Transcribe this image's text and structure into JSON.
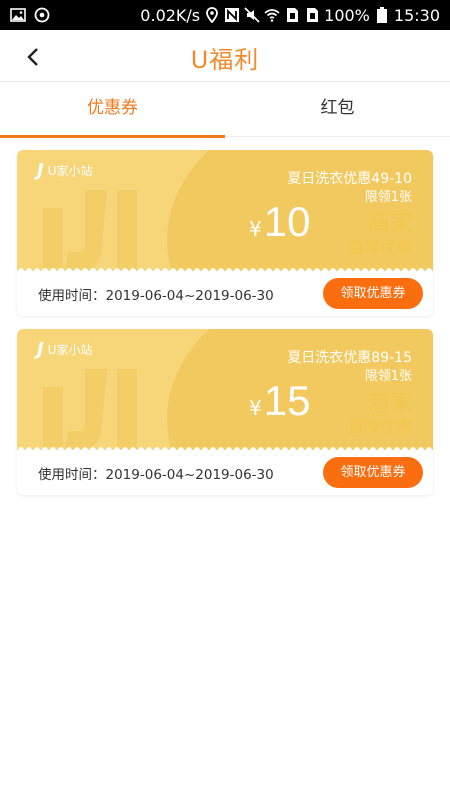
{
  "status_bar": {
    "speed": "0.02K/s",
    "battery": "100%",
    "time": "15:30",
    "icons": [
      "image-icon",
      "sync-icon",
      "location-icon",
      "nfc-icon",
      "mute-icon",
      "wifi-icon",
      "sim1-icon",
      "sim2-icon",
      "battery-icon"
    ]
  },
  "header": {
    "title": "U福利",
    "back_icon": "chevron-left-icon"
  },
  "tabs": [
    {
      "label": "优惠券",
      "active": true
    },
    {
      "label": "红包",
      "active": false
    }
  ],
  "coupons": [
    {
      "logo": "U家小站",
      "title": "夏日洗衣优惠49-10",
      "limit": "限领1张",
      "currency": "¥",
      "amount": "10",
      "merchant_1": "商家",
      "merchant_2": "直降优惠",
      "date": "使用时间：2019-06-04~2019-06-30",
      "button": "领取优惠券"
    },
    {
      "logo": "U家小站",
      "title": "夏日洗衣优惠89-15",
      "limit": "限领1张",
      "currency": "¥",
      "amount": "15",
      "merchant_1": "商家",
      "merchant_2": "直降优惠",
      "date": "使用时间：2019-06-04~2019-06-30",
      "button": "领取优惠券"
    }
  ],
  "colors": {
    "accent": "#f07a1e",
    "button": "#fb6e10",
    "coupon_bg": "#f6d679",
    "coupon_arc": "#f2c95f",
    "merchant_text": "#f1c64f"
  }
}
